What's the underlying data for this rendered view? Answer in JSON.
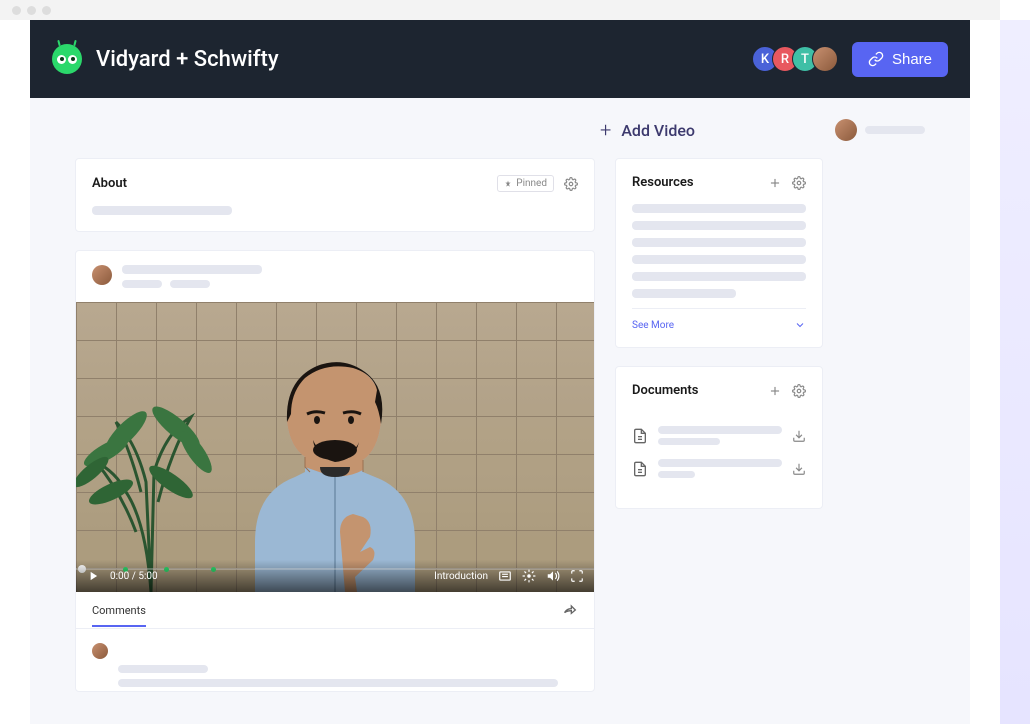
{
  "header": {
    "title": "Vidyard + Schwifty",
    "avatars": [
      {
        "letter": "K",
        "color": "#4a62d8"
      },
      {
        "letter": "R",
        "color": "#e8585f"
      },
      {
        "letter": "T",
        "color": "#3fbfa6"
      }
    ],
    "share_label": "Share"
  },
  "add_video_label": "Add Video",
  "about": {
    "title": "About",
    "pinned_label": "Pinned"
  },
  "video": {
    "time_current": "0:00",
    "time_total": "5:00",
    "chapter": "Introduction"
  },
  "comments": {
    "tab_label": "Comments"
  },
  "resources": {
    "title": "Resources",
    "see_more": "See More"
  },
  "documents": {
    "title": "Documents"
  }
}
